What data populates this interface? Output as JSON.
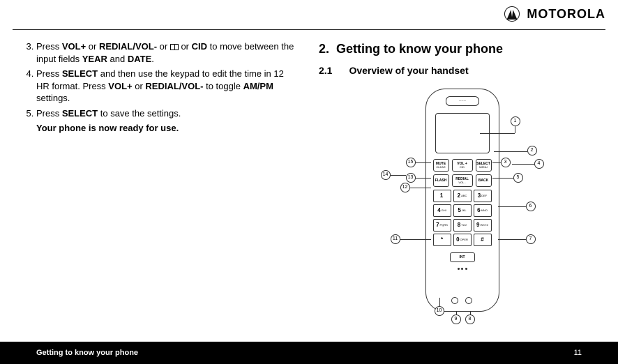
{
  "brand": "MOTOROLA",
  "left": {
    "items": [
      {
        "pre": "Press ",
        "b1": "VOL+",
        "mid1": " or ",
        "b2": "REDIAL/VOL-",
        "mid2": " or ",
        "icon": "book",
        "mid3": " or ",
        "b3": "CID",
        "mid4": " to move between the input fields ",
        "b4": "YEAR",
        "mid5": " and ",
        "b5": "DATE",
        "post": "."
      },
      {
        "pre": "Press ",
        "b1": "SELECT",
        "mid1": " and then use the keypad to edit the time in 12 HR format. Press ",
        "b2": "VOL+",
        "mid2": " or ",
        "b3": "REDIAL/VOL-",
        "mid3": " to toggle ",
        "b4": "AM/PM",
        "mid4": " settings.",
        "b5": "",
        "mid5": "",
        "post": ""
      },
      {
        "pre": "Press ",
        "b1": "SELECT",
        "mid1": " to save the settings.",
        "b2": "",
        "mid2": "",
        "b3": "",
        "mid3": "",
        "b4": "",
        "mid4": "",
        "b5": "",
        "mid5": "",
        "post": ""
      }
    ],
    "after": "Your phone is now ready for use."
  },
  "right": {
    "sec_num": "2.",
    "sec_title": "Getting to know your phone",
    "sub_num": "2.1",
    "sub_title": "Overview of your handset"
  },
  "handset": {
    "func_row1": {
      "left_top": "MUTE",
      "left_bot": "CLEAR",
      "mid_top": "VOL +",
      "right_top": "SELECT",
      "right_bot": "MENU"
    },
    "func_row2": {
      "left": "FLASH",
      "mid_top": "REDIAL",
      "mid_bot": "VOL -",
      "right": "BACK"
    },
    "keys": [
      {
        "n": "1",
        "l": ""
      },
      {
        "n": "2",
        "l": "ABC"
      },
      {
        "n": "3",
        "l": "DEF"
      },
      {
        "n": "4",
        "l": "GHI"
      },
      {
        "n": "5",
        "l": "JKL"
      },
      {
        "n": "6",
        "l": "MNO"
      },
      {
        "n": "7",
        "l": "PQRS"
      },
      {
        "n": "8",
        "l": "TUV"
      },
      {
        "n": "9",
        "l": "WXYZ"
      },
      {
        "n": "*",
        "l": ""
      },
      {
        "n": "0",
        "l": "OPER"
      },
      {
        "n": "#",
        "l": ""
      }
    ],
    "int": "INT",
    "nav_cid": "CID"
  },
  "callouts": [
    "1",
    "2",
    "3",
    "4",
    "5",
    "6",
    "7",
    "8",
    "9",
    "10",
    "11",
    "12",
    "13",
    "14",
    "15"
  ],
  "footer": {
    "left": "Getting to know your phone",
    "right": "11"
  }
}
